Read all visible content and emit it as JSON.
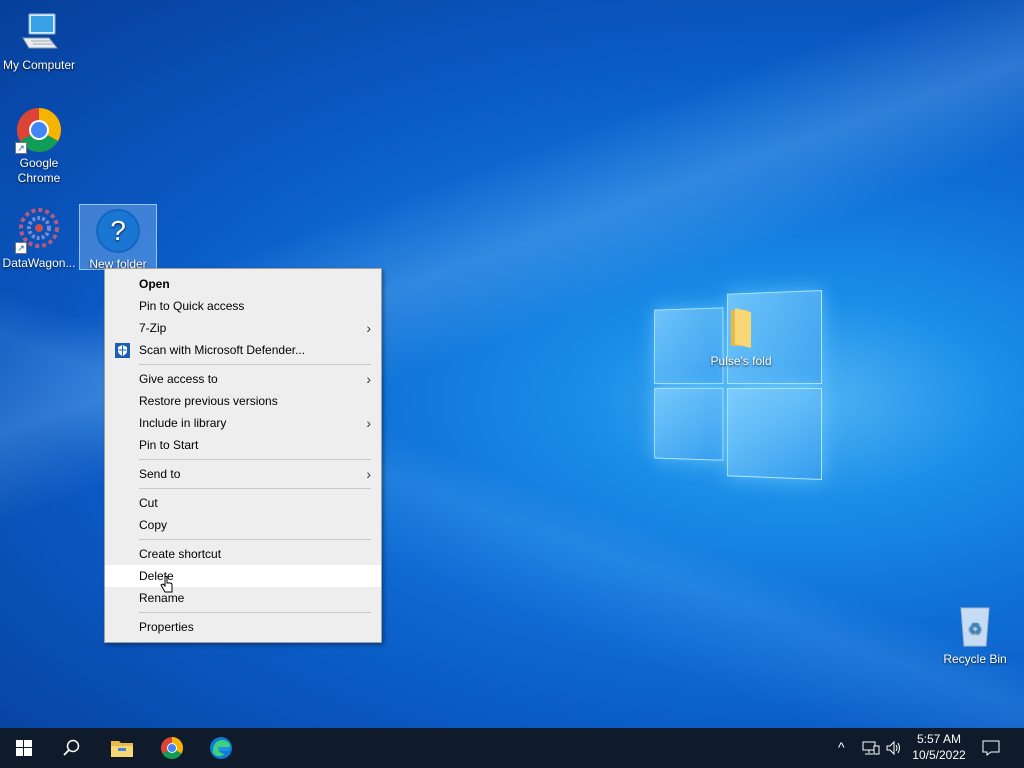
{
  "desktop": {
    "icons": [
      {
        "label": "My Computer",
        "icon": "computer-icon"
      },
      {
        "label": "Google Chrome",
        "icon": "chrome-icon"
      },
      {
        "label": "DataWagon...",
        "icon": "datawagon-icon"
      },
      {
        "label": "New folder",
        "icon": "unknown-file-icon"
      },
      {
        "label": "Pulse's fold",
        "icon": "folder-icon"
      },
      {
        "label": "Recycle Bin",
        "icon": "recycle-bin-icon"
      }
    ]
  },
  "context_menu": {
    "items": [
      {
        "label": "Open",
        "bold": true
      },
      {
        "label": "Pin to Quick access"
      },
      {
        "label": "7-Zip",
        "submenu": true
      },
      {
        "label": "Scan with Microsoft Defender...",
        "icon": "defender-shield-icon"
      },
      {
        "label": "Give access to",
        "submenu": true
      },
      {
        "label": "Restore previous versions"
      },
      {
        "label": "Include in library",
        "submenu": true
      },
      {
        "label": "Pin to Start"
      },
      {
        "label": "Send to",
        "submenu": true
      },
      {
        "label": "Cut"
      },
      {
        "label": "Copy"
      },
      {
        "label": "Create shortcut"
      },
      {
        "label": "Delete",
        "hovered": true
      },
      {
        "label": "Rename"
      },
      {
        "label": "Properties"
      }
    ],
    "submenu_arrow": "›"
  },
  "taskbar": {
    "start": "windows-start-icon",
    "search": "search-icon",
    "apps": [
      "file-explorer-icon",
      "chrome-icon",
      "edge-icon"
    ],
    "tray": {
      "chevron": "^",
      "time": "5:57 AM",
      "date": "10/5/2022"
    }
  },
  "colors": {
    "menu_bg": "#eeeeee",
    "menu_hover": "#ffffff",
    "taskbar_bg": "#0f1b2a",
    "accent": "#0a58c2"
  }
}
